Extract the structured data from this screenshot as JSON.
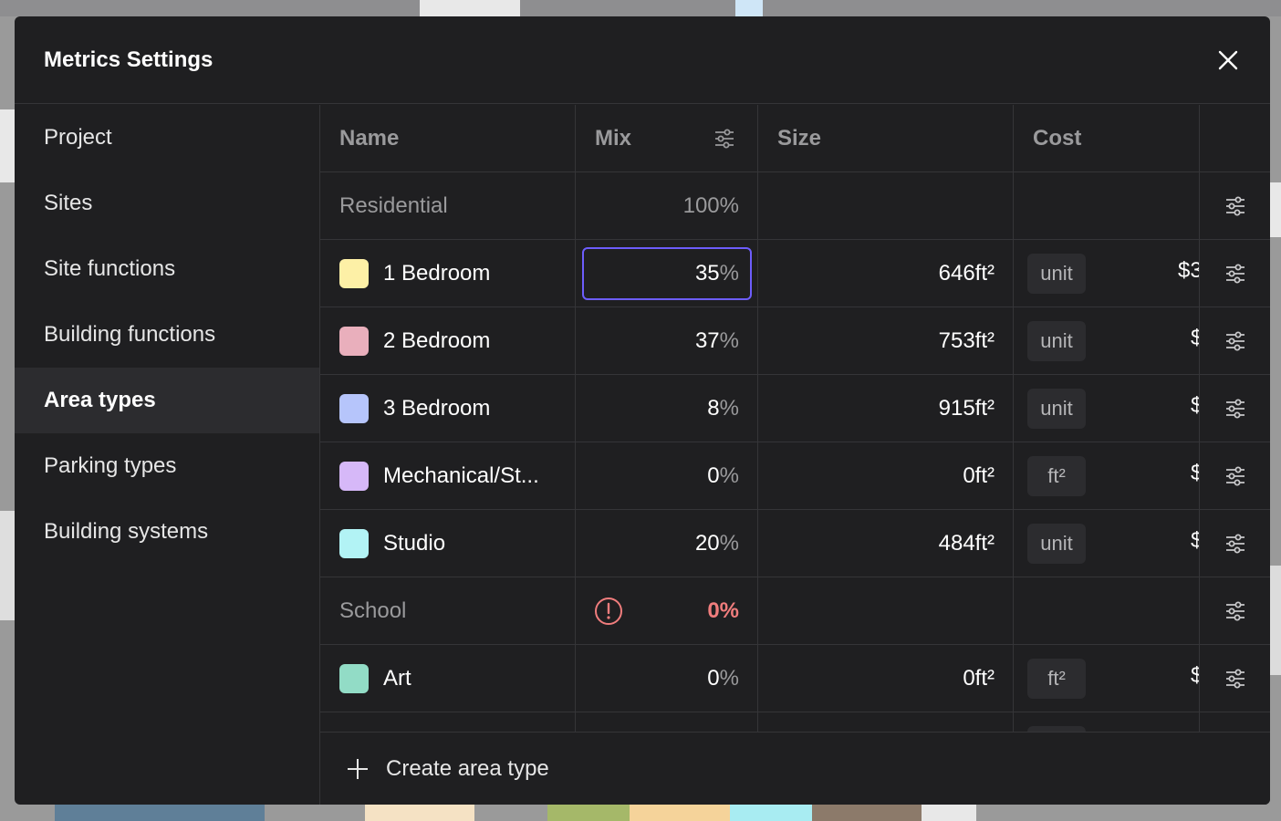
{
  "modal": {
    "title": "Metrics Settings"
  },
  "sidebar": {
    "items": [
      {
        "label": "Project"
      },
      {
        "label": "Sites"
      },
      {
        "label": "Site functions"
      },
      {
        "label": "Building functions"
      },
      {
        "label": "Area types",
        "active": true
      },
      {
        "label": "Parking types"
      },
      {
        "label": "Building systems"
      }
    ]
  },
  "table": {
    "headers": {
      "name": "Name",
      "mix": "Mix",
      "size": "Size",
      "cost": "Cost"
    },
    "rows": [
      {
        "type": "group",
        "name": "Residential",
        "mix_value": "100",
        "mix_unit": "%"
      },
      {
        "type": "item",
        "name": "1 Bedroom",
        "color": "#fdf0a6",
        "mix_value": "35",
        "mix_unit": "%",
        "size": "646ft²",
        "cost_unit": "unit",
        "cost": "$3",
        "focused": true
      },
      {
        "type": "item",
        "name": "2 Bedroom",
        "color": "#e9afbc",
        "mix_value": "37",
        "mix_unit": "%",
        "size": "753ft²",
        "cost_unit": "unit",
        "cost": "$"
      },
      {
        "type": "item",
        "name": "3 Bedroom",
        "color": "#b6c5fb",
        "mix_value": "8",
        "mix_unit": "%",
        "size": "915ft²",
        "cost_unit": "unit",
        "cost": "$"
      },
      {
        "type": "item",
        "name": "Mechanical/St...",
        "color": "#d6b8f8",
        "mix_value": "0",
        "mix_unit": "%",
        "size": "0ft²",
        "cost_unit": "ft²",
        "cost": "$"
      },
      {
        "type": "item",
        "name": "Studio",
        "color": "#b2f3f5",
        "mix_value": "20",
        "mix_unit": "%",
        "size": "484ft²",
        "cost_unit": "unit",
        "cost": "$"
      },
      {
        "type": "group-warn",
        "name": "School",
        "mix_value": "0%"
      },
      {
        "type": "item",
        "name": "Art",
        "color": "#92dcc6",
        "mix_value": "0",
        "mix_unit": "%",
        "size": "0ft²",
        "cost_unit": "ft²",
        "cost": "$"
      }
    ]
  },
  "footer": {
    "create_label": "Create area type"
  },
  "colors": {
    "accent": "#6d5dfc",
    "warning": "#f07d7d",
    "panel": "#1f1f21"
  },
  "icons": {
    "close": "close-icon",
    "sliders": "sliders-icon",
    "warning": "warning-icon",
    "plus": "plus-icon"
  }
}
